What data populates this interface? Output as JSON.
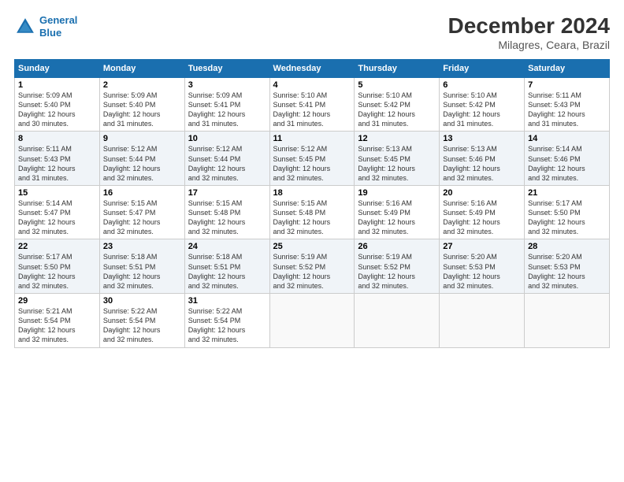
{
  "header": {
    "logo_line1": "General",
    "logo_line2": "Blue",
    "title": "December 2024",
    "subtitle": "Milagres, Ceara, Brazil"
  },
  "columns": [
    "Sunday",
    "Monday",
    "Tuesday",
    "Wednesday",
    "Thursday",
    "Friday",
    "Saturday"
  ],
  "weeks": [
    [
      {
        "day": "1",
        "info": "Sunrise: 5:09 AM\nSunset: 5:40 PM\nDaylight: 12 hours\nand 30 minutes."
      },
      {
        "day": "2",
        "info": "Sunrise: 5:09 AM\nSunset: 5:40 PM\nDaylight: 12 hours\nand 31 minutes."
      },
      {
        "day": "3",
        "info": "Sunrise: 5:09 AM\nSunset: 5:41 PM\nDaylight: 12 hours\nand 31 minutes."
      },
      {
        "day": "4",
        "info": "Sunrise: 5:10 AM\nSunset: 5:41 PM\nDaylight: 12 hours\nand 31 minutes."
      },
      {
        "day": "5",
        "info": "Sunrise: 5:10 AM\nSunset: 5:42 PM\nDaylight: 12 hours\nand 31 minutes."
      },
      {
        "day": "6",
        "info": "Sunrise: 5:10 AM\nSunset: 5:42 PM\nDaylight: 12 hours\nand 31 minutes."
      },
      {
        "day": "7",
        "info": "Sunrise: 5:11 AM\nSunset: 5:43 PM\nDaylight: 12 hours\nand 31 minutes."
      }
    ],
    [
      {
        "day": "8",
        "info": "Sunrise: 5:11 AM\nSunset: 5:43 PM\nDaylight: 12 hours\nand 31 minutes."
      },
      {
        "day": "9",
        "info": "Sunrise: 5:12 AM\nSunset: 5:44 PM\nDaylight: 12 hours\nand 32 minutes."
      },
      {
        "day": "10",
        "info": "Sunrise: 5:12 AM\nSunset: 5:44 PM\nDaylight: 12 hours\nand 32 minutes."
      },
      {
        "day": "11",
        "info": "Sunrise: 5:12 AM\nSunset: 5:45 PM\nDaylight: 12 hours\nand 32 minutes."
      },
      {
        "day": "12",
        "info": "Sunrise: 5:13 AM\nSunset: 5:45 PM\nDaylight: 12 hours\nand 32 minutes."
      },
      {
        "day": "13",
        "info": "Sunrise: 5:13 AM\nSunset: 5:46 PM\nDaylight: 12 hours\nand 32 minutes."
      },
      {
        "day": "14",
        "info": "Sunrise: 5:14 AM\nSunset: 5:46 PM\nDaylight: 12 hours\nand 32 minutes."
      }
    ],
    [
      {
        "day": "15",
        "info": "Sunrise: 5:14 AM\nSunset: 5:47 PM\nDaylight: 12 hours\nand 32 minutes."
      },
      {
        "day": "16",
        "info": "Sunrise: 5:15 AM\nSunset: 5:47 PM\nDaylight: 12 hours\nand 32 minutes."
      },
      {
        "day": "17",
        "info": "Sunrise: 5:15 AM\nSunset: 5:48 PM\nDaylight: 12 hours\nand 32 minutes."
      },
      {
        "day": "18",
        "info": "Sunrise: 5:15 AM\nSunset: 5:48 PM\nDaylight: 12 hours\nand 32 minutes."
      },
      {
        "day": "19",
        "info": "Sunrise: 5:16 AM\nSunset: 5:49 PM\nDaylight: 12 hours\nand 32 minutes."
      },
      {
        "day": "20",
        "info": "Sunrise: 5:16 AM\nSunset: 5:49 PM\nDaylight: 12 hours\nand 32 minutes."
      },
      {
        "day": "21",
        "info": "Sunrise: 5:17 AM\nSunset: 5:50 PM\nDaylight: 12 hours\nand 32 minutes."
      }
    ],
    [
      {
        "day": "22",
        "info": "Sunrise: 5:17 AM\nSunset: 5:50 PM\nDaylight: 12 hours\nand 32 minutes."
      },
      {
        "day": "23",
        "info": "Sunrise: 5:18 AM\nSunset: 5:51 PM\nDaylight: 12 hours\nand 32 minutes."
      },
      {
        "day": "24",
        "info": "Sunrise: 5:18 AM\nSunset: 5:51 PM\nDaylight: 12 hours\nand 32 minutes."
      },
      {
        "day": "25",
        "info": "Sunrise: 5:19 AM\nSunset: 5:52 PM\nDaylight: 12 hours\nand 32 minutes."
      },
      {
        "day": "26",
        "info": "Sunrise: 5:19 AM\nSunset: 5:52 PM\nDaylight: 12 hours\nand 32 minutes."
      },
      {
        "day": "27",
        "info": "Sunrise: 5:20 AM\nSunset: 5:53 PM\nDaylight: 12 hours\nand 32 minutes."
      },
      {
        "day": "28",
        "info": "Sunrise: 5:20 AM\nSunset: 5:53 PM\nDaylight: 12 hours\nand 32 minutes."
      }
    ],
    [
      {
        "day": "29",
        "info": "Sunrise: 5:21 AM\nSunset: 5:54 PM\nDaylight: 12 hours\nand 32 minutes."
      },
      {
        "day": "30",
        "info": "Sunrise: 5:22 AM\nSunset: 5:54 PM\nDaylight: 12 hours\nand 32 minutes."
      },
      {
        "day": "31",
        "info": "Sunrise: 5:22 AM\nSunset: 5:54 PM\nDaylight: 12 hours\nand 32 minutes."
      },
      {
        "day": "",
        "info": ""
      },
      {
        "day": "",
        "info": ""
      },
      {
        "day": "",
        "info": ""
      },
      {
        "day": "",
        "info": ""
      }
    ]
  ]
}
